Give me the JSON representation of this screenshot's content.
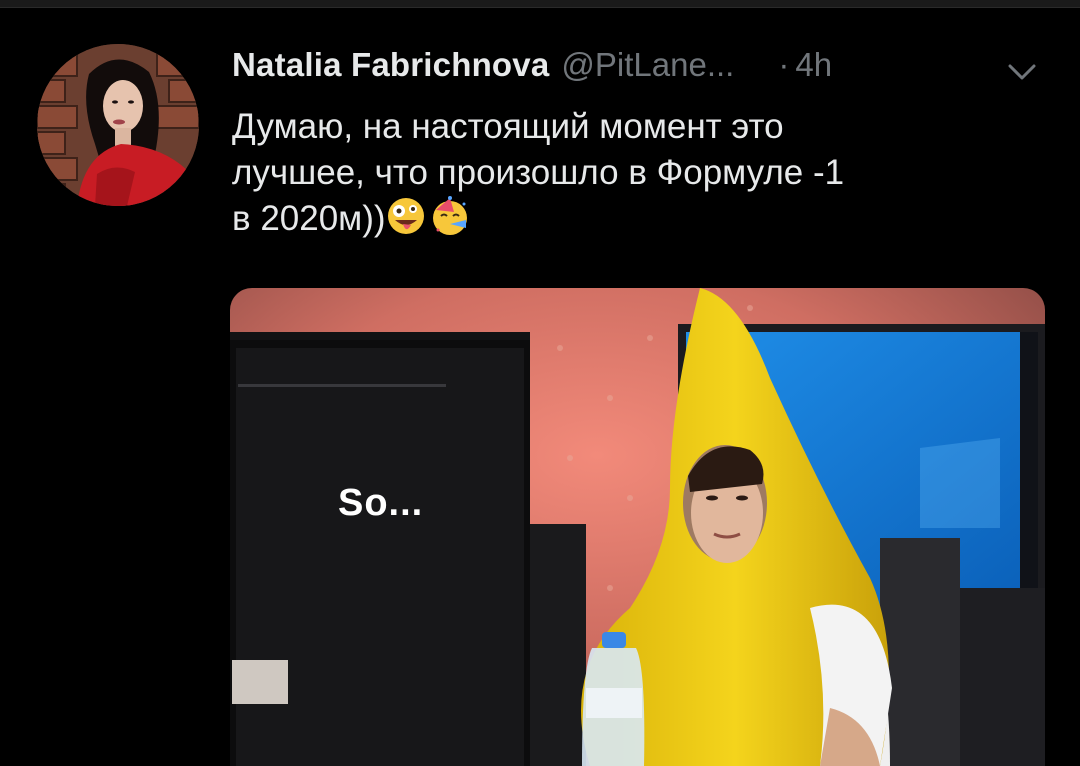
{
  "tweet": {
    "display_name": "Natalia Fabrichnova",
    "handle": "@PitLane...",
    "separator": "·",
    "time": "4h",
    "text_lines": [
      "Думаю, на настоящий момент это",
      "лучшее, что произошло в Формуле -1",
      "в 2020м))"
    ],
    "emojis": [
      "zany-face-emoji",
      "partying-face-emoji"
    ],
    "media": {
      "overlay_text": "So...",
      "description_icon": "banana-costume-photo"
    }
  },
  "colors": {
    "background": "#000000",
    "primary_text": "#e7e9ea",
    "secondary_text": "#71767b"
  }
}
